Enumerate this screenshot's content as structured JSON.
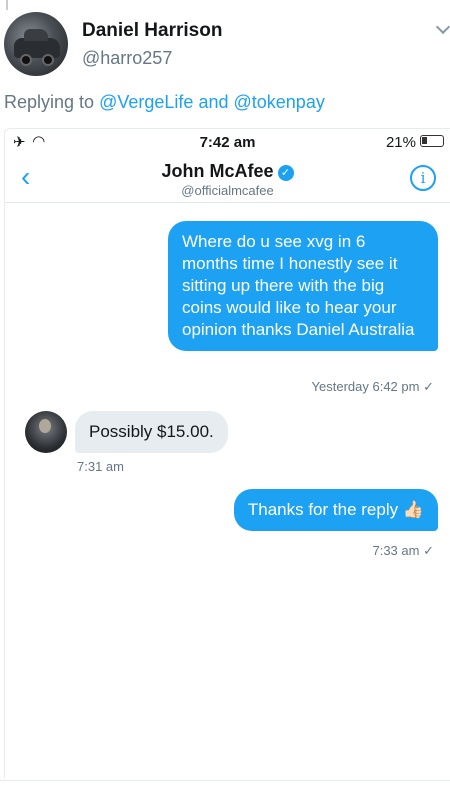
{
  "tweet": {
    "display_name": "Daniel Harrison",
    "handle": "@harro257",
    "replying_prefix": "Replying to",
    "mention_1": "@VergeLife",
    "and": "and",
    "mention_2": "@tokenpay"
  },
  "phone": {
    "status": {
      "time": "7:42 am",
      "battery": "21%",
      "airplane_icon": "airplane-icon",
      "wifi_icon": "wifi-icon"
    },
    "nav": {
      "back_icon": "chevron-left-icon",
      "contact_name": "John McAfee",
      "contact_handle": "@officialmcafee",
      "info_icon": "info-icon"
    },
    "messages": [
      {
        "direction": "outgoing",
        "text": "Where do u see xvg in 6 months time I honestly see it sitting up there with the big coins would like to hear your opinion thanks Daniel Australia",
        "timestamp": "Yesterday 6:42 pm",
        "status": "✓"
      },
      {
        "direction": "incoming",
        "text": "Possibly $15.00.",
        "timestamp": "7:31 am"
      },
      {
        "direction": "outgoing",
        "text": "Thanks for the reply 👍🏻",
        "timestamp": "7:33 am",
        "status": "✓"
      }
    ]
  },
  "colors": {
    "accent": "#1da1f2",
    "incoming_bubble": "#e6ecf0",
    "secondary_text": "#657786"
  }
}
